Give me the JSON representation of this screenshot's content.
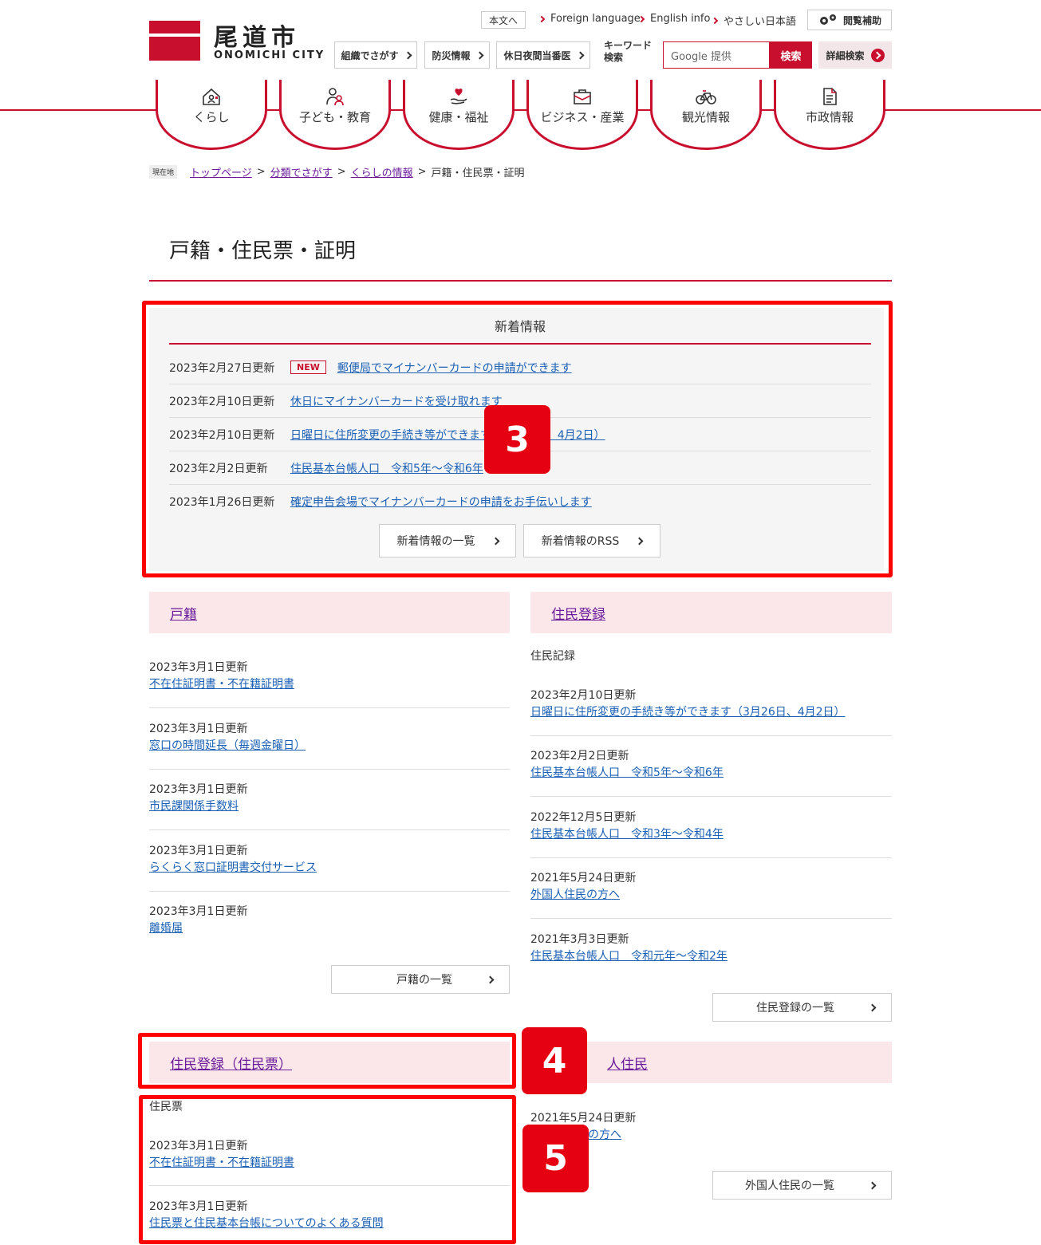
{
  "header": {
    "logo_jp": "尾道市",
    "logo_en": "ONOMICHI CITY",
    "skip_link": "本文へ",
    "top_links": [
      "Foreign language",
      "English info",
      "やさしい日本語"
    ],
    "assist_btn": "閲覧補助",
    "quick_btns": [
      "組織でさがす",
      "防災情報",
      "休日夜間当番医"
    ],
    "keyword_label_1": "キーワード",
    "keyword_label_2": "検索",
    "search_placeholder": "Google 提供",
    "search_btn": "検索",
    "adv_search_btn": "詳細検索"
  },
  "nav": {
    "items": [
      {
        "label": "くらし",
        "icon": "house-person-icon"
      },
      {
        "label": "子ども・教育",
        "icon": "parent-child-icon"
      },
      {
        "label": "健康・福祉",
        "icon": "heart-hand-icon"
      },
      {
        "label": "ビジネス・産業",
        "icon": "briefcase-icon"
      },
      {
        "label": "観光情報",
        "icon": "bicycle-icon"
      },
      {
        "label": "市政情報",
        "icon": "document-icon"
      }
    ]
  },
  "breadcrumb": {
    "here": "現在地",
    "items": [
      "トップページ",
      "分類でさがす",
      "くらしの情報"
    ],
    "current": "戸籍・住民票・証明"
  },
  "page_title": "戸籍・住民票・証明",
  "news": {
    "title": "新着情報",
    "new_tag": "NEW",
    "rows": [
      {
        "date": "2023年2月27日更新",
        "text": "郵便局でマイナンバーカードの申請ができます"
      },
      {
        "date": "2023年2月10日更新",
        "text": "休日にマイナンバーカードを受け取れます"
      },
      {
        "date": "2023年2月10日更新",
        "text": "日曜日に住所変更の手続き等ができます（3月26日、4月2日）"
      },
      {
        "date": "2023年2月2日更新",
        "text": "住民基本台帳人口　令和5年～令和6年"
      },
      {
        "date": "2023年1月26日更新",
        "text": "確定申告会場でマイナンバーカードの申請をお手伝いします"
      }
    ],
    "list_btn": "新着情報の一覧",
    "rss_btn": "新着情報のRSS"
  },
  "koseki": {
    "title": "戸籍",
    "items": [
      {
        "date": "2023年3月1日更新",
        "text": "不在住証明書・不在籍証明書"
      },
      {
        "date": "2023年3月1日更新",
        "text": "窓口の時間延長（毎週金曜日）"
      },
      {
        "date": "2023年3月1日更新",
        "text": "市民課関係手数料"
      },
      {
        "date": "2023年3月1日更新",
        "text": "らくらく窓口証明書交付サービス"
      },
      {
        "date": "2023年3月1日更新",
        "text": "離婚届"
      }
    ],
    "list_btn": "戸籍の一覧"
  },
  "juminto": {
    "title": "住民登録",
    "sub": "住民記録",
    "items": [
      {
        "date": "2023年2月10日更新",
        "text": "日曜日に住所変更の手続き等ができます（3月26日、4月2日）"
      },
      {
        "date": "2023年2月2日更新",
        "text": "住民基本台帳人口　令和5年～令和6年"
      },
      {
        "date": "2022年12月5日更新",
        "text": "住民基本台帳人口　令和3年～令和4年"
      },
      {
        "date": "2021年5月24日更新",
        "text": "外国人住民の方へ"
      },
      {
        "date": "2021年3月3日更新",
        "text": "住民基本台帳人口　令和元年～令和2年"
      }
    ],
    "list_btn": "住民登録の一覧"
  },
  "juminhyo": {
    "title": "住民登録（住民票）",
    "sub": "住民票",
    "items": [
      {
        "date": "2023年3月1日更新",
        "text": "不在住証明書・不在籍証明書"
      },
      {
        "date": "2023年3月1日更新",
        "text": "住民票と住民基本台帳についてのよくある質問"
      }
    ]
  },
  "gaikoku": {
    "title_visible": "人住民",
    "items": [
      {
        "date": "2021年5月24日更新",
        "text": "の方へ"
      }
    ],
    "list_btn": "外国人住民の一覧"
  },
  "annotations": [
    "3",
    "4",
    "5"
  ],
  "colors": {
    "brand_red": "#c8102e",
    "annotation_red": "#ff0000",
    "section_bg": "#fbe6e9"
  }
}
